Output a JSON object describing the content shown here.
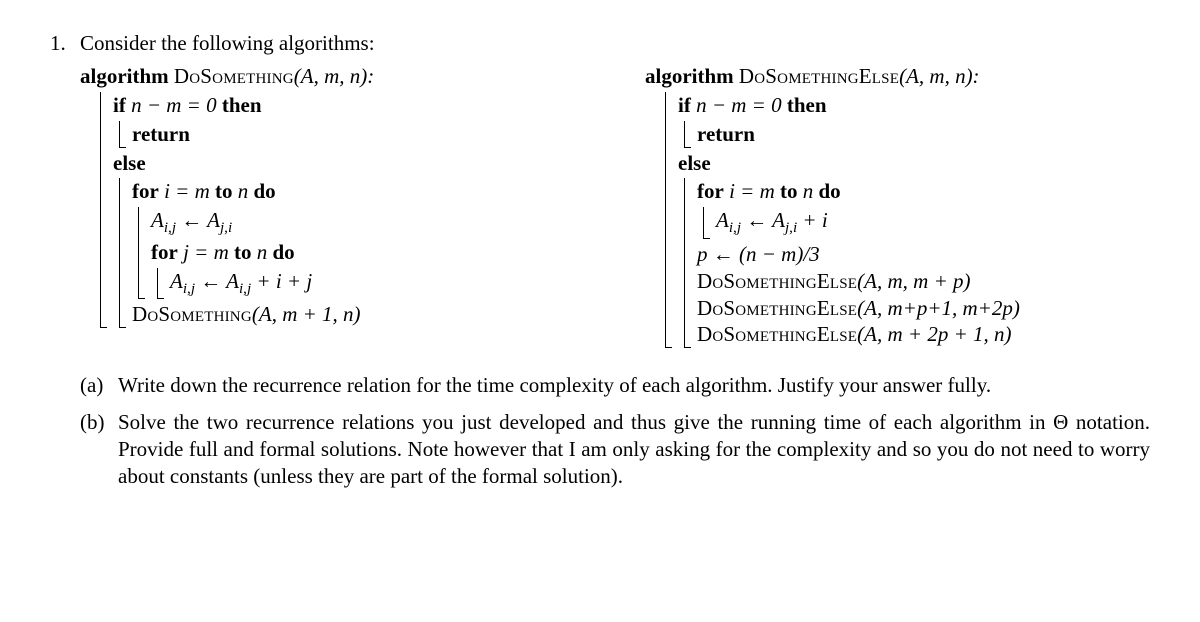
{
  "problem_number": "1.",
  "intro": "Consider the following algorithms:",
  "algo1": {
    "header_kw": "algorithm",
    "header_name": "DoSomething",
    "header_args": "(A, m, n):",
    "line_if": "if",
    "line_if_cond": " n − m = 0 ",
    "line_then": "then",
    "line_return": "return",
    "line_else": "else",
    "line_for_i": "for",
    "line_for_i_cond": " i = m ",
    "line_to": "to",
    "line_for_i_n": " n ",
    "line_do": "do",
    "line_assign1_lhs": "A",
    "line_assign1_sub1": "i,j",
    "line_assign1_arrow": " ← ",
    "line_assign1_rhs": "A",
    "line_assign1_sub2": "j,i",
    "line_for_j": "for",
    "line_for_j_cond": " j = m ",
    "line_for_j_n": " n ",
    "line_assign2_lhs": "A",
    "line_assign2_sub1": "i,j",
    "line_assign2_rhs": "A",
    "line_assign2_sub2": "i,j",
    "line_assign2_tail": " + i + j",
    "line_rec_name": "DoSomething",
    "line_rec_args": "(A, m + 1, n)"
  },
  "algo2": {
    "header_kw": "algorithm",
    "header_name": "DoSomethingElse",
    "header_args": "(A, m, n):",
    "line_if": "if",
    "line_if_cond": " n − m = 0 ",
    "line_then": "then",
    "line_return": "return",
    "line_else": "else",
    "line_for_i": "for",
    "line_for_i_cond": " i = m ",
    "line_to": "to",
    "line_for_i_n": " n ",
    "line_do": "do",
    "line_assign1_lhs": "A",
    "line_assign1_sub1": "i,j",
    "line_assign1_arrow": " ← ",
    "line_assign1_rhs": "A",
    "line_assign1_sub2": "j,i",
    "line_assign1_tail": " + i",
    "line_p": "p ← (n − m)/3",
    "line_rec1_name": "DoSomethingElse",
    "line_rec1_args": "(A, m, m + p)",
    "line_rec2_name": "DoSomethingElse",
    "line_rec2_args": "(A, m+p+1, m+2p)",
    "line_rec3_name": "DoSomethingElse",
    "line_rec3_args": "(A, m + 2p + 1, n)"
  },
  "part_a": {
    "label": "(a)",
    "text": "Write down the recurrence relation for the time complexity of each algorithm. Justify your answer fully."
  },
  "part_b": {
    "label": "(b)",
    "text": "Solve the two recurrence relations you just developed and thus give the running time of each algorithm in Θ notation. Provide full and formal solutions. Note however that I am only asking for the complexity and so you do not need to worry about constants (unless they are part of the formal solution)."
  }
}
